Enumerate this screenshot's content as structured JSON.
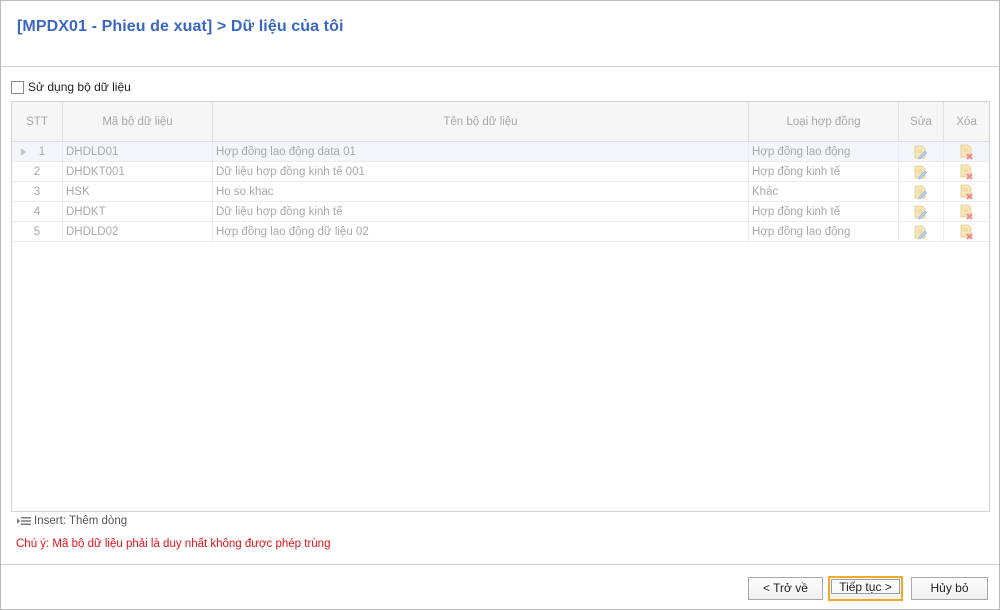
{
  "header": {
    "title": "[MPDX01 - Phieu de xuat] > Dữ liệu của tôi"
  },
  "options": {
    "use_dataset_label": "Sử dụng bộ dữ liệu",
    "use_dataset_checked": false
  },
  "grid": {
    "columns": {
      "stt": "STT",
      "code": "Mã bộ dữ liệu",
      "name": "Tên bộ dữ liệu",
      "contract_type": "Loại hợp đồng",
      "edit": "Sửa",
      "delete": "Xóa"
    },
    "rows": [
      {
        "stt": "1",
        "code": "DHDLD01",
        "name": "Hợp đồng lao động data 01",
        "contract_type": "Hợp đồng lao động"
      },
      {
        "stt": "2",
        "code": "DHDKT001",
        "name": "Dữ liệu hợp đồng kinh tế 001",
        "contract_type": "Hợp đồng kinh tế"
      },
      {
        "stt": "3",
        "code": "HSK",
        "name": "Ho so khac",
        "contract_type": "Khác"
      },
      {
        "stt": "4",
        "code": "DHDKT",
        "name": "Dữ liệu hợp đồng kinh tế",
        "contract_type": "Hợp đồng kinh tế"
      },
      {
        "stt": "5",
        "code": "DHDLD02",
        "name": "Hợp đồng lao động dữ liệu 02",
        "contract_type": "Hợp đồng lao động"
      }
    ],
    "selected_row": 1
  },
  "hints": {
    "insert": "Insert: Thêm dòng",
    "note": "Chú ý: Mã bộ dữ liệu phải là duy nhất không được phép trùng"
  },
  "footer": {
    "back_label": "< Trở về",
    "next_label": "Tiếp tục >",
    "cancel_label": "Hủy bỏ"
  },
  "icons": {
    "edit": "edit-pencil-icon",
    "delete": "delete-x-icon",
    "insert": "insert-row-icon"
  },
  "colors": {
    "title": "#3b67c4",
    "note": "#e0121b",
    "primary_button_border": "#f0a92e"
  }
}
